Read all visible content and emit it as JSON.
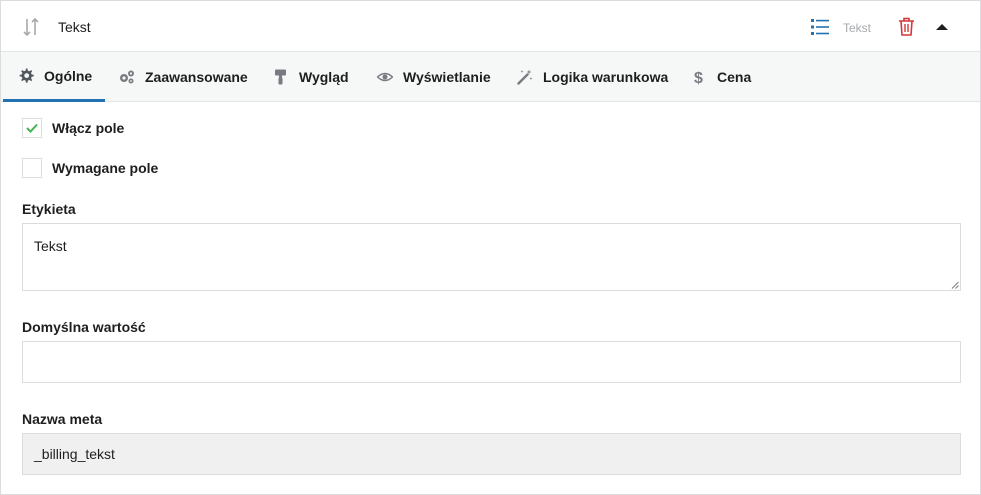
{
  "header": {
    "field_title": "Tekst",
    "field_type": "Tekst"
  },
  "tabs": [
    {
      "label": "Ogólne",
      "icon": "gear-icon",
      "active": true
    },
    {
      "label": "Zaawansowane",
      "icon": "gears-icon",
      "active": false
    },
    {
      "label": "Wygląd",
      "icon": "paint-roller-icon",
      "active": false
    },
    {
      "label": "Wyświetlanie",
      "icon": "eye-icon",
      "active": false
    },
    {
      "label": "Logika warunkowa",
      "icon": "magic-wand-icon",
      "active": false
    },
    {
      "label": "Cena",
      "icon": "dollar-icon",
      "active": false
    }
  ],
  "form": {
    "enable_field": {
      "label": "Włącz pole",
      "checked": true
    },
    "required_field": {
      "label": "Wymagane pole",
      "checked": false
    },
    "label_field": {
      "label": "Etykieta",
      "value": "Tekst"
    },
    "default_value_field": {
      "label": "Domyślna wartość",
      "value": ""
    },
    "meta_name_field": {
      "label": "Nazwa meta",
      "value": "_billing_tekst"
    }
  },
  "colors": {
    "accent": "#2271b1",
    "check": "#46b450",
    "trash": "#d63638",
    "tab_bar": "#f6f7f7"
  }
}
